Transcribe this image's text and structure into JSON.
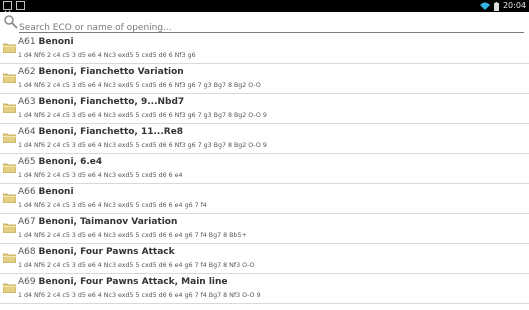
{
  "status_bar": {
    "time": "20:04"
  },
  "search": {
    "placeholder": "Search ECO or name of opening..."
  },
  "openings": [
    {
      "eco": "A61",
      "name": "Benoni",
      "moves": "1 d4 Nf6 2 c4 c5 3 d5 e6 4 Nc3 exd5 5 cxd5 d6 6 Nf3 g6"
    },
    {
      "eco": "A62",
      "name": "Benoni, Fianchetto Variation",
      "moves": "1 d4 Nf6 2 c4 c5 3 d5 e6 4 Nc3 exd5 5 cxd5 d6 6 Nf3 g6 7 g3 Bg7 8 Bg2 O-O"
    },
    {
      "eco": "A63",
      "name": "Benoni, Fianchetto, 9...Nbd7",
      "moves": "1 d4 Nf6 2 c4 c5 3 d5 e6 4 Nc3 exd5 5 cxd5 d6 6 Nf3 g6 7 g3 Bg7 8 Bg2 O-O 9"
    },
    {
      "eco": "A64",
      "name": "Benoni, Fianchetto, 11...Re8",
      "moves": "1 d4 Nf6 2 c4 c5 3 d5 e6 4 Nc3 exd5 5 cxd5 d6 6 Nf3 g6 7 g3 Bg7 8 Bg2 O-O 9"
    },
    {
      "eco": "A65",
      "name": "Benoni, 6.e4",
      "moves": "1 d4 Nf6 2 c4 c5 3 d5 e6 4 Nc3 exd5 5 cxd5 d6 6 e4"
    },
    {
      "eco": "A66",
      "name": "Benoni",
      "moves": "1 d4 Nf6 2 c4 c5 3 d5 e6 4 Nc3 exd5 5 cxd5 d6 6 e4 g6 7 f4"
    },
    {
      "eco": "A67",
      "name": "Benoni, Taimanov Variation",
      "moves": "1 d4 Nf6 2 c4 c5 3 d5 e6 4 Nc3 exd5 5 cxd5 d6 6 e4 g6 7 f4 Bg7 8 Bb5+"
    },
    {
      "eco": "A68",
      "name": "Benoni, Four Pawns Attack",
      "moves": "1 d4 Nf6 2 c4 c5 3 d5 e6 4 Nc3 exd5 5 cxd5 d6 6 e4 g6 7 f4 Bg7 8 Nf3 O-O"
    },
    {
      "eco": "A69",
      "name": "Benoni, Four Pawns Attack, Main line",
      "moves": "1 d4 Nf6 2 c4 c5 3 d5 e6 4 Nc3 exd5 5 cxd5 d6 6 e4 g6 7 f4 Bg7 8 Nf3 O-O 9"
    }
  ]
}
